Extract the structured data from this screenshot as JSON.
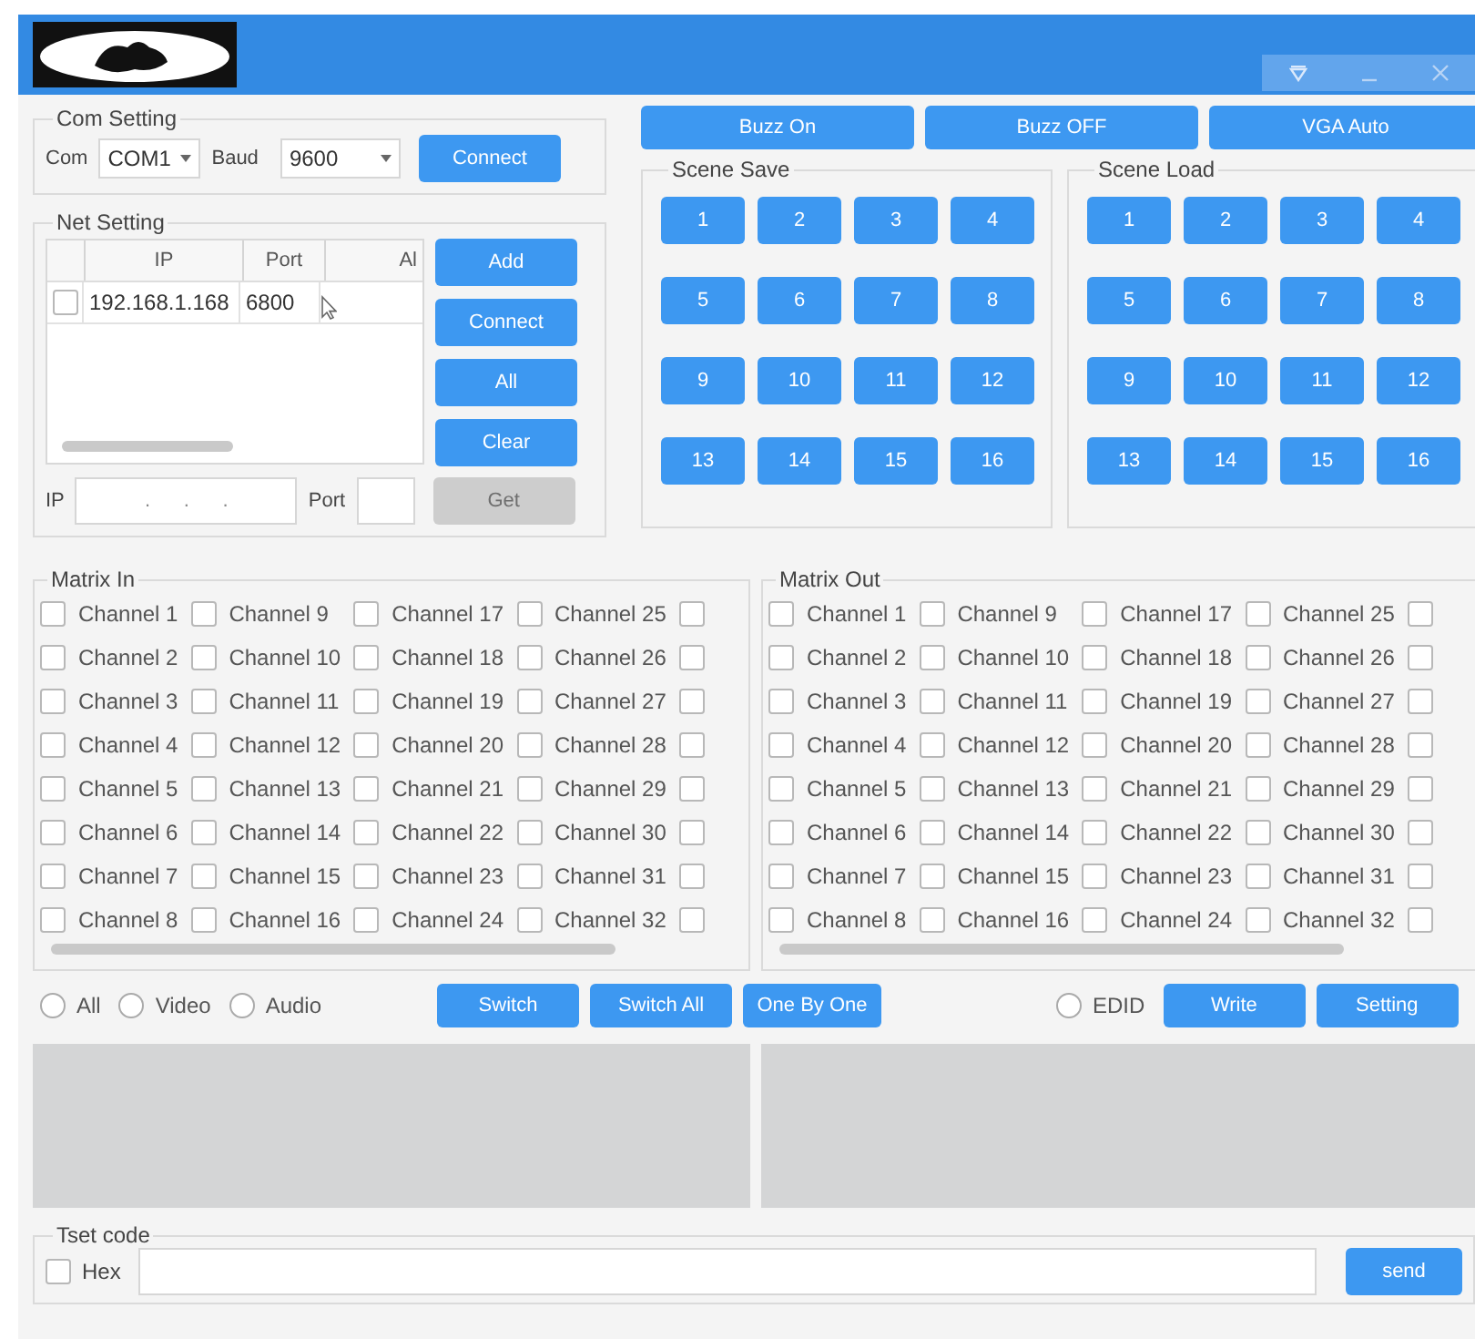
{
  "com_setting": {
    "title": "Com Setting",
    "com_label": "Com",
    "com_value": "COM1",
    "baud_label": "Baud",
    "baud_value": "9600",
    "connect": "Connect"
  },
  "net_setting": {
    "title": "Net Setting",
    "columns": [
      "IP",
      "Port",
      "Al"
    ],
    "rows": [
      {
        "checked": false,
        "ip": "192.168.1.168",
        "port": "6800"
      }
    ],
    "buttons": [
      "Add",
      "Connect",
      "All",
      "Clear"
    ],
    "get": {
      "label": "Get",
      "disabled": true
    },
    "ip_label": "IP",
    "ip_mask": ".      .      .",
    "port_label": "Port"
  },
  "top_buttons": [
    "Buzz On",
    "Buzz OFF",
    "VGA Auto"
  ],
  "scene_save": {
    "title": "Scene Save",
    "buttons": [
      "1",
      "2",
      "3",
      "4",
      "5",
      "6",
      "7",
      "8",
      "9",
      "10",
      "11",
      "12",
      "13",
      "14",
      "15",
      "16"
    ]
  },
  "scene_load": {
    "title": "Scene Load",
    "buttons": [
      "1",
      "2",
      "3",
      "4",
      "5",
      "6",
      "7",
      "8",
      "9",
      "10",
      "11",
      "12",
      "13",
      "14",
      "15",
      "16"
    ]
  },
  "matrix_in": {
    "title": "Matrix In",
    "channels": [
      {
        "label": "Channel 1",
        "checked": false
      },
      {
        "label": "Channel 2",
        "checked": false
      },
      {
        "label": "Channel 3",
        "checked": false
      },
      {
        "label": "Channel 4",
        "checked": false
      },
      {
        "label": "Channel 5",
        "checked": false
      },
      {
        "label": "Channel 6",
        "checked": false
      },
      {
        "label": "Channel 7",
        "checked": false
      },
      {
        "label": "Channel 8",
        "checked": false
      },
      {
        "label": "Channel 9",
        "checked": false
      },
      {
        "label": "Channel 10",
        "checked": false
      },
      {
        "label": "Channel 11",
        "checked": false
      },
      {
        "label": "Channel 12",
        "checked": false
      },
      {
        "label": "Channel 13",
        "checked": false
      },
      {
        "label": "Channel 14",
        "checked": false
      },
      {
        "label": "Channel 15",
        "checked": false
      },
      {
        "label": "Channel 16",
        "checked": false
      },
      {
        "label": "Channel 17",
        "checked": false
      },
      {
        "label": "Channel 18",
        "checked": false
      },
      {
        "label": "Channel 19",
        "checked": false
      },
      {
        "label": "Channel 20",
        "checked": false
      },
      {
        "label": "Channel 21",
        "checked": false
      },
      {
        "label": "Channel 22",
        "checked": false
      },
      {
        "label": "Channel 23",
        "checked": false
      },
      {
        "label": "Channel 24",
        "checked": false
      },
      {
        "label": "Channel 25",
        "checked": false
      },
      {
        "label": "Channel 26",
        "checked": false
      },
      {
        "label": "Channel 27",
        "checked": false
      },
      {
        "label": "Channel 28",
        "checked": false
      },
      {
        "label": "Channel 29",
        "checked": false
      },
      {
        "label": "Channel 30",
        "checked": false
      },
      {
        "label": "Channel 31",
        "checked": false
      },
      {
        "label": "Channel 32",
        "checked": false
      }
    ],
    "cut_column": [
      {
        "checked": false
      },
      {
        "checked": false
      },
      {
        "checked": false
      },
      {
        "checked": false
      },
      {
        "checked": false
      },
      {
        "checked": false
      },
      {
        "checked": false
      },
      {
        "checked": false
      }
    ]
  },
  "matrix_out": {
    "title": "Matrix Out",
    "channels": [
      {
        "label": "Channel 1",
        "checked": false
      },
      {
        "label": "Channel 2",
        "checked": false
      },
      {
        "label": "Channel 3",
        "checked": false
      },
      {
        "label": "Channel 4",
        "checked": false
      },
      {
        "label": "Channel 5",
        "checked": false
      },
      {
        "label": "Channel 6",
        "checked": false
      },
      {
        "label": "Channel 7",
        "checked": false
      },
      {
        "label": "Channel 8",
        "checked": false
      },
      {
        "label": "Channel 9",
        "checked": false
      },
      {
        "label": "Channel 10",
        "checked": false
      },
      {
        "label": "Channel 11",
        "checked": false
      },
      {
        "label": "Channel 12",
        "checked": false
      },
      {
        "label": "Channel 13",
        "checked": false
      },
      {
        "label": "Channel 14",
        "checked": false
      },
      {
        "label": "Channel 15",
        "checked": false
      },
      {
        "label": "Channel 16",
        "checked": false
      },
      {
        "label": "Channel 17",
        "checked": false
      },
      {
        "label": "Channel 18",
        "checked": false
      },
      {
        "label": "Channel 19",
        "checked": false
      },
      {
        "label": "Channel 20",
        "checked": false
      },
      {
        "label": "Channel 21",
        "checked": false
      },
      {
        "label": "Channel 22",
        "checked": false
      },
      {
        "label": "Channel 23",
        "checked": false
      },
      {
        "label": "Channel 24",
        "checked": false
      },
      {
        "label": "Channel 25",
        "checked": false
      },
      {
        "label": "Channel 26",
        "checked": false
      },
      {
        "label": "Channel 27",
        "checked": false
      },
      {
        "label": "Channel 28",
        "checked": false
      },
      {
        "label": "Channel 29",
        "checked": false
      },
      {
        "label": "Channel 30",
        "checked": false
      },
      {
        "label": "Channel 31",
        "checked": false
      },
      {
        "label": "Channel 32",
        "checked": false
      }
    ],
    "cut_column": [
      {
        "checked": false
      },
      {
        "checked": false
      },
      {
        "checked": false
      },
      {
        "checked": false
      },
      {
        "checked": false
      },
      {
        "checked": false
      },
      {
        "checked": false
      },
      {
        "checked": false
      }
    ]
  },
  "modes": [
    {
      "label": "All",
      "selected": false
    },
    {
      "label": "Video",
      "selected": false
    },
    {
      "label": "Audio",
      "selected": false
    }
  ],
  "actions": [
    "Switch",
    "Switch All",
    "One By One"
  ],
  "edid": {
    "label": "EDID",
    "selected": false
  },
  "edid_buttons": [
    "Write",
    "Setting"
  ],
  "test_code": {
    "title": "Tset code",
    "hex": {
      "label": "Hex",
      "checked": false
    },
    "send": "send"
  }
}
